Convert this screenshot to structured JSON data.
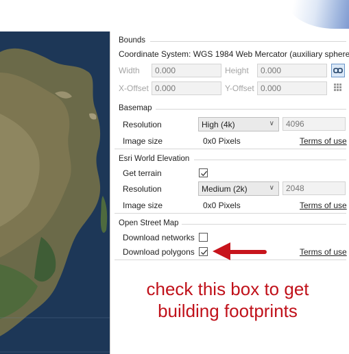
{
  "bounds": {
    "title": "Bounds",
    "coordinate_system": "Coordinate System: WGS 1984 Web Mercator (auxiliary sphere)",
    "width_label": "Width",
    "width_value": "0.000",
    "height_label": "Height",
    "height_value": "0.000",
    "xoffset_label": "X-Offset",
    "xoffset_value": "0.000",
    "yoffset_label": "Y-Offset",
    "yoffset_value": "0.000"
  },
  "basemap": {
    "title": "Basemap",
    "resolution_label": "Resolution",
    "resolution_selected": "High (4k)",
    "resolution_pixels": "4096",
    "image_size_label": "Image size",
    "image_size_value": "0x0 Pixels",
    "terms": "Terms of use"
  },
  "elevation": {
    "title": "Esri World Elevation",
    "get_terrain_label": "Get terrain",
    "get_terrain_checked": true,
    "resolution_label": "Resolution",
    "resolution_selected": "Medium (2k)",
    "resolution_pixels": "2048",
    "image_size_label": "Image size",
    "image_size_value": "0x0 Pixels",
    "terms": "Terms of use"
  },
  "osm": {
    "title": "Open Street Map",
    "networks_label": "Download networks",
    "networks_checked": false,
    "polygons_label": "Download polygons",
    "polygons_checked": true,
    "terms": "Terms of use"
  },
  "annotation": {
    "line1": "check this box to get",
    "line2": "building footprints",
    "color": "#c0111a"
  },
  "icons": [
    "link-toggle-icon",
    "grid-icon",
    "chevron-down-icon",
    "checkmark-icon",
    "red-arrow-icon"
  ]
}
